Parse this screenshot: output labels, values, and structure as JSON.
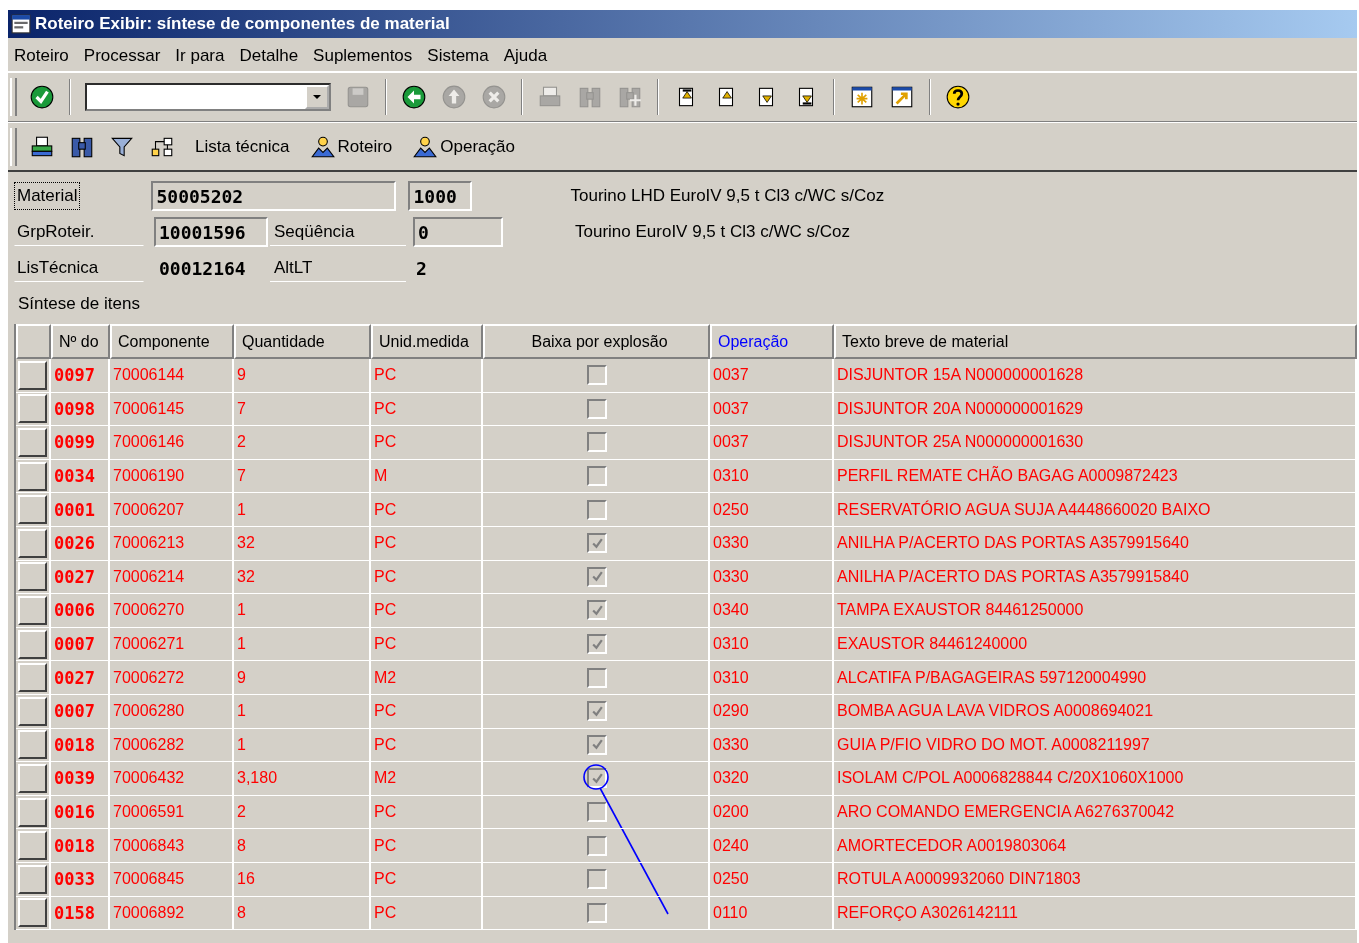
{
  "window": {
    "title": "Roteiro Exibir: síntese de componentes de material"
  },
  "menu": [
    "Roteiro",
    "Processar",
    "Ir para",
    "Detalhe",
    "Suplementos",
    "Sistema",
    "Ajuda"
  ],
  "standard_toolbar": [
    [
      {
        "kind": "enter",
        "disabled": false
      }
    ],
    [
      {
        "kind": "command_field",
        "disabled": false
      },
      {
        "kind": "save",
        "disabled": true
      }
    ],
    [
      {
        "kind": "back",
        "disabled": false
      },
      {
        "kind": "exit",
        "disabled": true
      },
      {
        "kind": "cancel",
        "disabled": true
      }
    ],
    [
      {
        "kind": "print",
        "disabled": true
      },
      {
        "kind": "find",
        "disabled": true
      },
      {
        "kind": "find_next",
        "disabled": true
      }
    ],
    [
      {
        "kind": "first_page",
        "disabled": false
      },
      {
        "kind": "prev_page",
        "disabled": false
      },
      {
        "kind": "next_page",
        "disabled": false
      },
      {
        "kind": "last_page",
        "disabled": false
      }
    ],
    [
      {
        "kind": "new_session",
        "disabled": false
      },
      {
        "kind": "shortcut",
        "disabled": false
      }
    ],
    [
      {
        "kind": "help",
        "disabled": false
      }
    ]
  ],
  "app_toolbar": [
    {
      "kind": "print"
    },
    {
      "kind": "find"
    },
    {
      "kind": "filter"
    },
    {
      "kind": "structure"
    },
    {
      "kind": "text",
      "label": "Lista técnica"
    },
    {
      "kind": "person",
      "label": "Roteiro"
    },
    {
      "kind": "person",
      "label": "Operação"
    }
  ],
  "header": {
    "material": {
      "label": "Material",
      "focused": true,
      "value": "50005202",
      "plant": "1000",
      "description": "Tourino LHD EuroIV 9,5 t Cl3 c/WC s/Coz"
    },
    "group": {
      "label": "GrpRoteir.",
      "value": "10001596",
      "counter_label": "Seqüência",
      "counter": "0",
      "description": "Tourino EuroIV 9,5 t Cl3 c/WC s/Coz"
    },
    "bom": {
      "label": "LisTécnica",
      "value": "00012164",
      "alt_label": "AltLT",
      "alt": "2"
    },
    "section": "Síntese de itens"
  },
  "table": {
    "columns": [
      {
        "label": "Nº do",
        "color": "#000000"
      },
      {
        "label": "Componente",
        "color": "#000000"
      },
      {
        "label": "Quantidade",
        "color": "#000000"
      },
      {
        "label": "Unid.medida",
        "color": "#000000"
      },
      {
        "label": "Baixa por explosão",
        "color": "#000000"
      },
      {
        "label": "Operação",
        "color": "#0000ff"
      },
      {
        "label": "Texto breve de material",
        "color": "#000000"
      }
    ],
    "rows": [
      {
        "no": "0097",
        "component": "70006144",
        "quantity": "9",
        "unit": "PC",
        "backflush": false,
        "operation": "0037",
        "text": "DISJUNTOR 15A N000000001628",
        "marked": false
      },
      {
        "no": "0098",
        "component": "70006145",
        "quantity": "7",
        "unit": "PC",
        "backflush": false,
        "operation": "0037",
        "text": "DISJUNTOR 20A N000000001629",
        "marked": false
      },
      {
        "no": "0099",
        "component": "70006146",
        "quantity": "2",
        "unit": "PC",
        "backflush": false,
        "operation": "0037",
        "text": "DISJUNTOR 25A N000000001630",
        "marked": false
      },
      {
        "no": "0034",
        "component": "70006190",
        "quantity": "7",
        "unit": "M",
        "backflush": false,
        "operation": "0310",
        "text": "PERFIL REMATE CHÃO BAGAG A0009872423",
        "marked": false
      },
      {
        "no": "0001",
        "component": "70006207",
        "quantity": "1",
        "unit": "PC",
        "backflush": false,
        "operation": "0250",
        "text": "RESERVATÓRIO AGUA SUJA A4448660020 BAIXO",
        "marked": false
      },
      {
        "no": "0026",
        "component": "70006213",
        "quantity": "32",
        "unit": "PC",
        "backflush": true,
        "operation": "0330",
        "text": "ANILHA P/ACERTO DAS PORTAS A3579915640",
        "marked": false
      },
      {
        "no": "0027",
        "component": "70006214",
        "quantity": "32",
        "unit": "PC",
        "backflush": true,
        "operation": "0330",
        "text": "ANILHA P/ACERTO DAS PORTAS A3579915840",
        "marked": false
      },
      {
        "no": "0006",
        "component": "70006270",
        "quantity": "1",
        "unit": "PC",
        "backflush": true,
        "operation": "0340",
        "text": "TAMPA EXAUSTOR 84461250000",
        "marked": false
      },
      {
        "no": "0007",
        "component": "70006271",
        "quantity": "1",
        "unit": "PC",
        "backflush": true,
        "operation": "0310",
        "text": "EXAUSTOR 84461240000",
        "marked": false
      },
      {
        "no": "0027",
        "component": "70006272",
        "quantity": "9",
        "unit": "M2",
        "backflush": false,
        "operation": "0310",
        "text": "ALCATIFA P/BAGAGEIRAS 597120004990",
        "marked": false
      },
      {
        "no": "0007",
        "component": "70006280",
        "quantity": "1",
        "unit": "PC",
        "backflush": true,
        "operation": "0290",
        "text": "BOMBA AGUA LAVA VIDROS A0008694021",
        "marked": false
      },
      {
        "no": "0018",
        "component": "70006282",
        "quantity": "1",
        "unit": "PC",
        "backflush": true,
        "operation": "0330",
        "text": "GUIA P/FIO VIDRO DO MOT. A0008211997",
        "marked": false
      },
      {
        "no": "0039",
        "component": "70006432",
        "quantity": "3,180",
        "unit": "M2",
        "backflush": true,
        "operation": "0320",
        "text": "ISOLAM C/POL A0006828844 C/20X1060X1000",
        "marked": true
      },
      {
        "no": "0016",
        "component": "70006591",
        "quantity": "2",
        "unit": "PC",
        "backflush": false,
        "operation": "0200",
        "text": "ARO COMANDO EMERGENCIA A6276370042",
        "marked": false
      },
      {
        "no": "0018",
        "component": "70006843",
        "quantity": "8",
        "unit": "PC",
        "backflush": false,
        "operation": "0240",
        "text": "AMORTECEDOR A0019803064",
        "marked": false
      },
      {
        "no": "0033",
        "component": "70006845",
        "quantity": "16",
        "unit": "PC",
        "backflush": false,
        "operation": "0250",
        "text": "ROTULA A0009932060 DIN71803",
        "marked": false
      },
      {
        "no": "0158",
        "component": "70006892",
        "quantity": "8",
        "unit": "PC",
        "backflush": false,
        "operation": "0110",
        "text": "REFORÇO A3026142111",
        "marked": false
      }
    ]
  }
}
